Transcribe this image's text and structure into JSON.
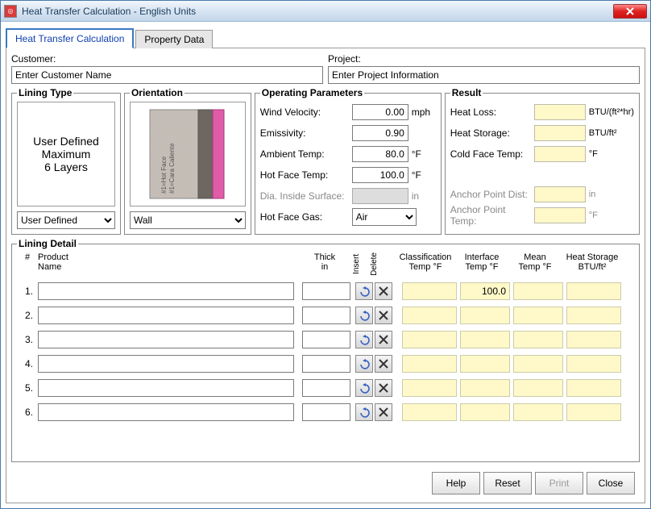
{
  "window": {
    "title": "Heat Transfer Calculation - English Units"
  },
  "tabs": {
    "calc": "Heat Transfer Calculation",
    "property": "Property Data"
  },
  "customer": {
    "label": "Customer:",
    "placeholder": "Enter Customer Name",
    "value": "Enter Customer Name"
  },
  "project": {
    "label": "Project:",
    "placeholder": "Enter Project Information",
    "value": "Enter Project Information"
  },
  "lining_type": {
    "legend": "Lining Type",
    "line1": "User Defined",
    "line2": "Maximum",
    "line3": "6 Layers",
    "select": "User Defined"
  },
  "orientation": {
    "legend": "Orientation",
    "select": "Wall",
    "img_label1": "#1=Hot Face",
    "img_label2": "#1=Cara Caliente"
  },
  "op": {
    "legend": "Operating Parameters",
    "wind_label": "Wind Velocity:",
    "wind_value": "0.00",
    "wind_unit": "mph",
    "emis_label": "Emissivity:",
    "emis_value": "0.90",
    "amb_label": "Ambient Temp:",
    "amb_value": "80.0",
    "amb_unit": "°F",
    "hot_label": "Hot Face Temp:",
    "hot_value": "100.0",
    "hot_unit": "°F",
    "dia_label": "Dia. Inside Surface:",
    "dia_unit": "in",
    "gas_label": "Hot Face Gas:",
    "gas_value": "Air"
  },
  "result": {
    "legend": "Result",
    "heatloss_label": "Heat Loss:",
    "heatloss_unit": "BTU/(ft²*hr)",
    "heatstorage_label": "Heat Storage:",
    "heatstorage_unit": "BTU/ft²",
    "coldface_label": "Cold Face Temp:",
    "coldface_unit": "°F",
    "anchor_dist_label": "Anchor Point Dist:",
    "anchor_dist_unit": "in",
    "anchor_temp_label": "Anchor Point Temp:",
    "anchor_temp_unit": "°F"
  },
  "lining_detail": {
    "legend": "Lining Detail",
    "col_num": "#",
    "col_name": "Product\nName",
    "col_name_l1": "Product",
    "col_name_l2": "Name",
    "col_thick_l1": "Thick",
    "col_thick_l2": "in",
    "col_insert": "Insert",
    "col_delete": "Delete",
    "col_class_l1": "Classification",
    "col_class_l2": "Temp °F",
    "col_interface_l1": "Interface",
    "col_interface_l2": "Temp °F",
    "col_mean_l1": "Mean",
    "col_mean_l2": "Temp °F",
    "col_hs_l1": "Heat Storage",
    "col_hs_l2": "BTU/ft²",
    "rows": [
      {
        "num": "1.",
        "interface": "100.0"
      },
      {
        "num": "2.",
        "interface": ""
      },
      {
        "num": "3.",
        "interface": ""
      },
      {
        "num": "4.",
        "interface": ""
      },
      {
        "num": "5.",
        "interface": ""
      },
      {
        "num": "6.",
        "interface": ""
      }
    ]
  },
  "buttons": {
    "help": "Help",
    "reset": "Reset",
    "print": "Print",
    "close": "Close"
  }
}
